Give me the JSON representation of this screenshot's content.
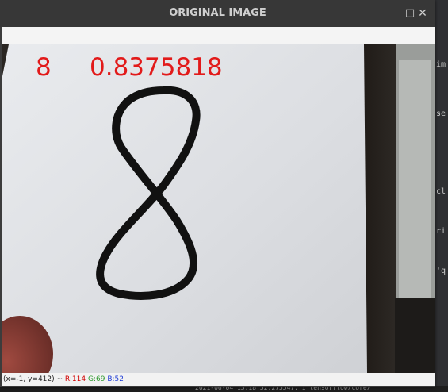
{
  "window": {
    "title": "ORIGINAL IMAGE",
    "minimize_icon": "minimize-icon",
    "maximize_icon": "maximize-icon",
    "close_icon": "close-icon"
  },
  "overlay": {
    "predicted_digit": "8",
    "confidence": "0.8375818",
    "color": "#e21a1a"
  },
  "status": {
    "coords": "(x=-1, y=412) ~",
    "r": "R:114",
    "g": "G:69",
    "b": "B:52"
  },
  "background_editor": {
    "fragments": [
      "im",
      "se",
      "cl",
      "ri",
      "'q"
    ],
    "terminal_text": "2021-06-04 13:18:52.275547: I tensorflow/core/"
  }
}
